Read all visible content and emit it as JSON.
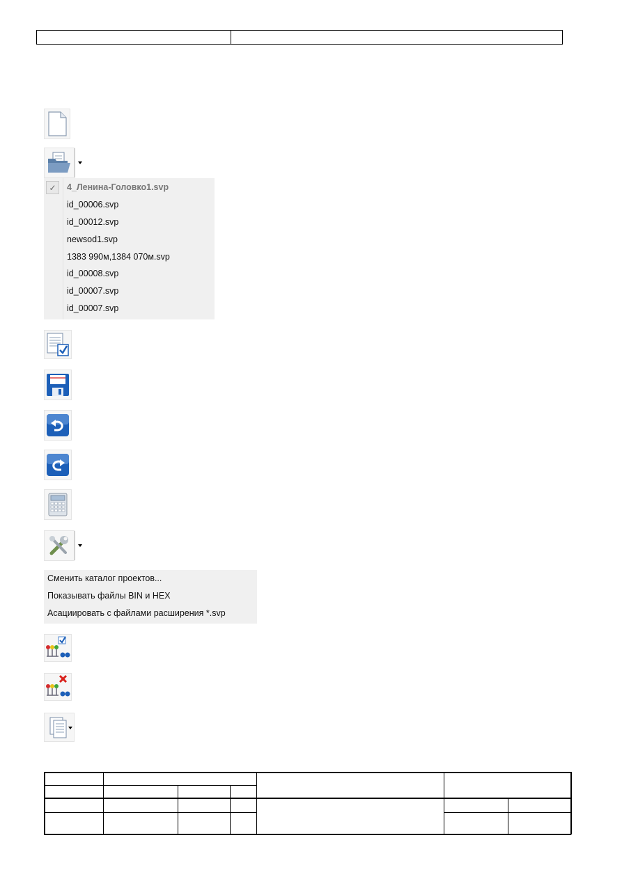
{
  "recent_files": {
    "items": [
      {
        "label": "4_Ленина-Головко1.svp",
        "checked": true
      },
      {
        "label": "id_00006.svp",
        "checked": false
      },
      {
        "label": "id_00012.svp",
        "checked": false
      },
      {
        "label": "newsod1.svp",
        "checked": false
      },
      {
        "label": "1383 990м,1384 070м.svp",
        "checked": false
      },
      {
        "label": "id_00008.svp",
        "checked": false
      },
      {
        "label": "id_00007.svp",
        "checked": false
      },
      {
        "label": "id_00007.svp",
        "checked": false
      }
    ],
    "check_mark": "✓"
  },
  "settings_menu": {
    "items": [
      "Сменить каталог проектов...",
      "Показывать файлы BIN и HEX",
      "Асациировать с файлами расширения *.svp"
    ]
  },
  "icons": [
    "new-document-icon",
    "open-folder-icon",
    "document-check-icon",
    "save-disk-icon",
    "undo-arrow-icon",
    "redo-arrow-icon",
    "calculator-icon",
    "tools-icon",
    "indicators-check-icon",
    "indicators-delete-icon",
    "copy-documents-icon"
  ],
  "colors": {
    "accent_blue": "#1c5fb8",
    "menu_bg": "#f0f0f0",
    "delete_red": "#d9221c"
  }
}
